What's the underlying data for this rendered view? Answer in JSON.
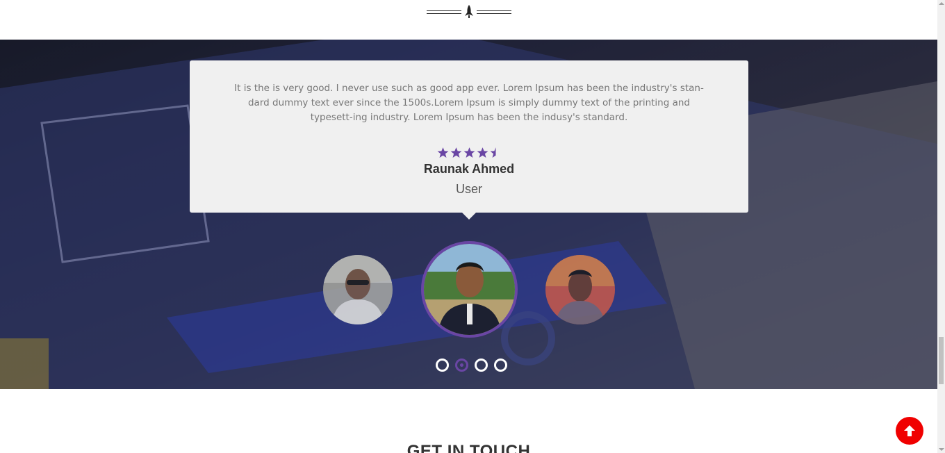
{
  "testimonial": {
    "quote": "It is the is very good. I never use such as good app ever. Lorem Ipsum has been the industry's stan-dard dummy text ever since the 1500s.Lorem Ipsum is simply dummy text of the printing and typesett-ing industry. Lorem Ipsum has been the indusy's standard.",
    "rating": 4.5,
    "rating_max": 5,
    "name": "Raunak Ahmed",
    "role": "User"
  },
  "carousel": {
    "slide_count": 4,
    "active_index": 1
  },
  "contact": {
    "title": "GET IN TOUCH"
  },
  "colors": {
    "accent": "#6a46a4",
    "card_bg": "#f0f0f0",
    "scroll_top_bg": "#f00000"
  },
  "icons": {
    "divider": "rocket-icon",
    "scroll_top": "arrow-up-icon"
  }
}
